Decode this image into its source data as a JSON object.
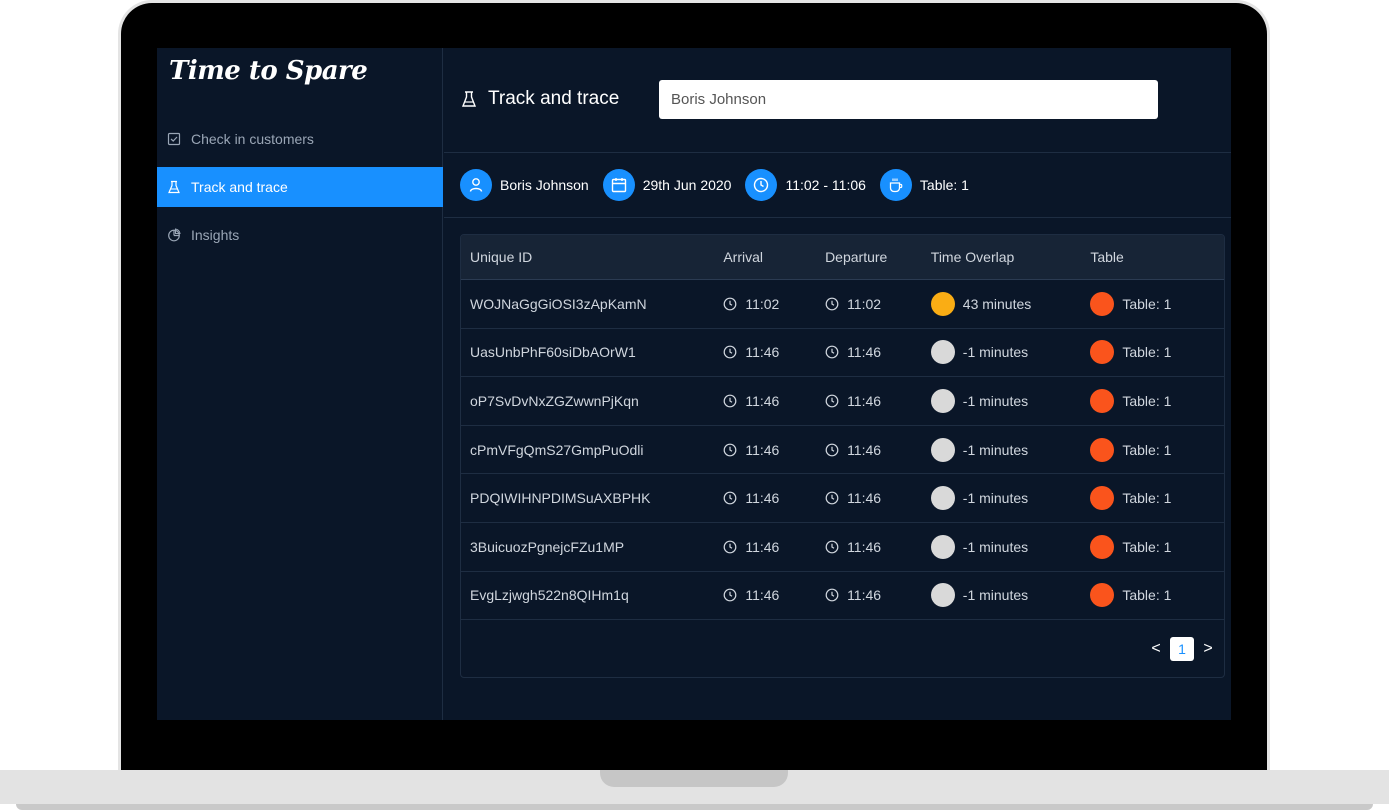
{
  "app": {
    "logo": "Time to Spare"
  },
  "sidebar": {
    "items": [
      {
        "label": "Check in customers",
        "icon": "checkbox-icon"
      },
      {
        "label": "Track and trace",
        "icon": "flask-icon",
        "active": true
      },
      {
        "label": "Insights",
        "icon": "pie-chart-icon"
      }
    ]
  },
  "header": {
    "title": "Track and trace",
    "search_value": "Boris Johnson"
  },
  "info": {
    "name": "Boris Johnson",
    "date": "29th Jun 2020",
    "time": "11:02 - 11:06",
    "table": "Table: 1"
  },
  "table": {
    "columns": [
      "Unique ID",
      "Arrival",
      "Departure",
      "Time Overlap",
      "Table"
    ],
    "rows": [
      {
        "id": "WOJNaGgGiOSI3zApKamN",
        "arrival": "11:02",
        "departure": "11:02",
        "overlap": "43 minutes",
        "overlap_color": "#faad14",
        "table": "Table: 1",
        "table_color": "#fa541c"
      },
      {
        "id": "UasUnbPhF60siDbAOrW1",
        "arrival": "11:46",
        "departure": "11:46",
        "overlap": "-1 minutes",
        "overlap_color": "#d9d9d9",
        "table": "Table: 1",
        "table_color": "#fa541c"
      },
      {
        "id": "oP7SvDvNxZGZwwnPjKqn",
        "arrival": "11:46",
        "departure": "11:46",
        "overlap": "-1 minutes",
        "overlap_color": "#d9d9d9",
        "table": "Table: 1",
        "table_color": "#fa541c"
      },
      {
        "id": "cPmVFgQmS27GmpPuOdli",
        "arrival": "11:46",
        "departure": "11:46",
        "overlap": "-1 minutes",
        "overlap_color": "#d9d9d9",
        "table": "Table: 1",
        "table_color": "#fa541c"
      },
      {
        "id": "PDQIWIHNPDIMSuAXBPHK",
        "arrival": "11:46",
        "departure": "11:46",
        "overlap": "-1 minutes",
        "overlap_color": "#d9d9d9",
        "table": "Table: 1",
        "table_color": "#fa541c"
      },
      {
        "id": "3BuicuozPgnejcFZu1MP",
        "arrival": "11:46",
        "departure": "11:46",
        "overlap": "-1 minutes",
        "overlap_color": "#d9d9d9",
        "table": "Table: 1",
        "table_color": "#fa541c"
      },
      {
        "id": "EvgLzjwgh522n8QIHm1q",
        "arrival": "11:46",
        "departure": "11:46",
        "overlap": "-1 minutes",
        "overlap_color": "#d9d9d9",
        "table": "Table: 1",
        "table_color": "#fa541c"
      }
    ]
  },
  "pagination": {
    "current": "1",
    "prev": "<",
    "next": ">"
  },
  "colors": {
    "accent": "#1890ff",
    "background": "#0a1628"
  }
}
